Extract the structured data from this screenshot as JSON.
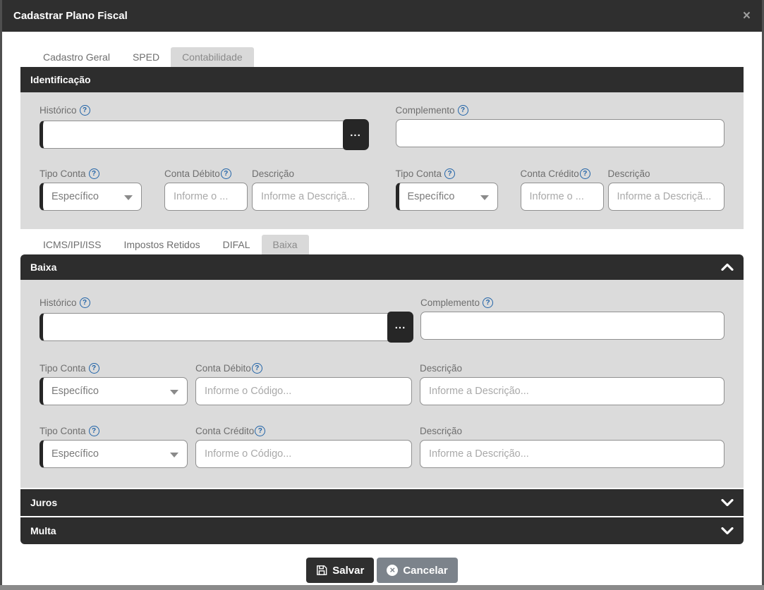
{
  "modal": {
    "title": "Cadastrar Plano Fiscal",
    "close_icon": "×"
  },
  "icons": {
    "help": "?",
    "more": "..."
  },
  "main_tabs": {
    "cadastro_geral": "Cadastro Geral",
    "sped": "SPED",
    "contabilidade": "Contabilidade"
  },
  "identificacao": {
    "header": "Identificação",
    "historico_label": "Histórico",
    "historico_value": "",
    "complemento_label": "Complemento",
    "complemento_value": "",
    "tipo_conta_label": "Tipo Conta",
    "tipo_conta_value": "Específico",
    "conta_debito_label": "Conta Débito",
    "conta_credito_label": "Conta Crédito",
    "codigo_placeholder": "Informe o ...",
    "descricao_label": "Descrição",
    "descricao_placeholder": "Informe a Descriçã..."
  },
  "sub_tabs": {
    "icms": "ICMS/IPI/ISS",
    "impostos_retidos": "Impostos Retidos",
    "difal": "DIFAL",
    "baixa": "Baixa"
  },
  "baixa": {
    "header": "Baixa",
    "historico_label": "Histórico",
    "historico_value": "",
    "complemento_label": "Complemento",
    "complemento_value": "",
    "tipo_conta_label": "Tipo Conta",
    "tipo_conta_value": "Específico",
    "conta_debito_label": "Conta Débito",
    "conta_credito_label": "Conta Crédito",
    "codigo_placeholder": "Informe o Código...",
    "descricao_label": "Descrição",
    "descricao_placeholder": "Informe a Descrição..."
  },
  "accordions": {
    "juros": "Juros",
    "multa": "Multa"
  },
  "footer": {
    "save": "Salvar",
    "cancel": "Cancelar"
  },
  "colors": {
    "accent_dark": "#2d2d2d",
    "panel_gray": "#dbdbdb",
    "help_blue": "#2264a8",
    "cancel_gray": "#7c838b"
  }
}
